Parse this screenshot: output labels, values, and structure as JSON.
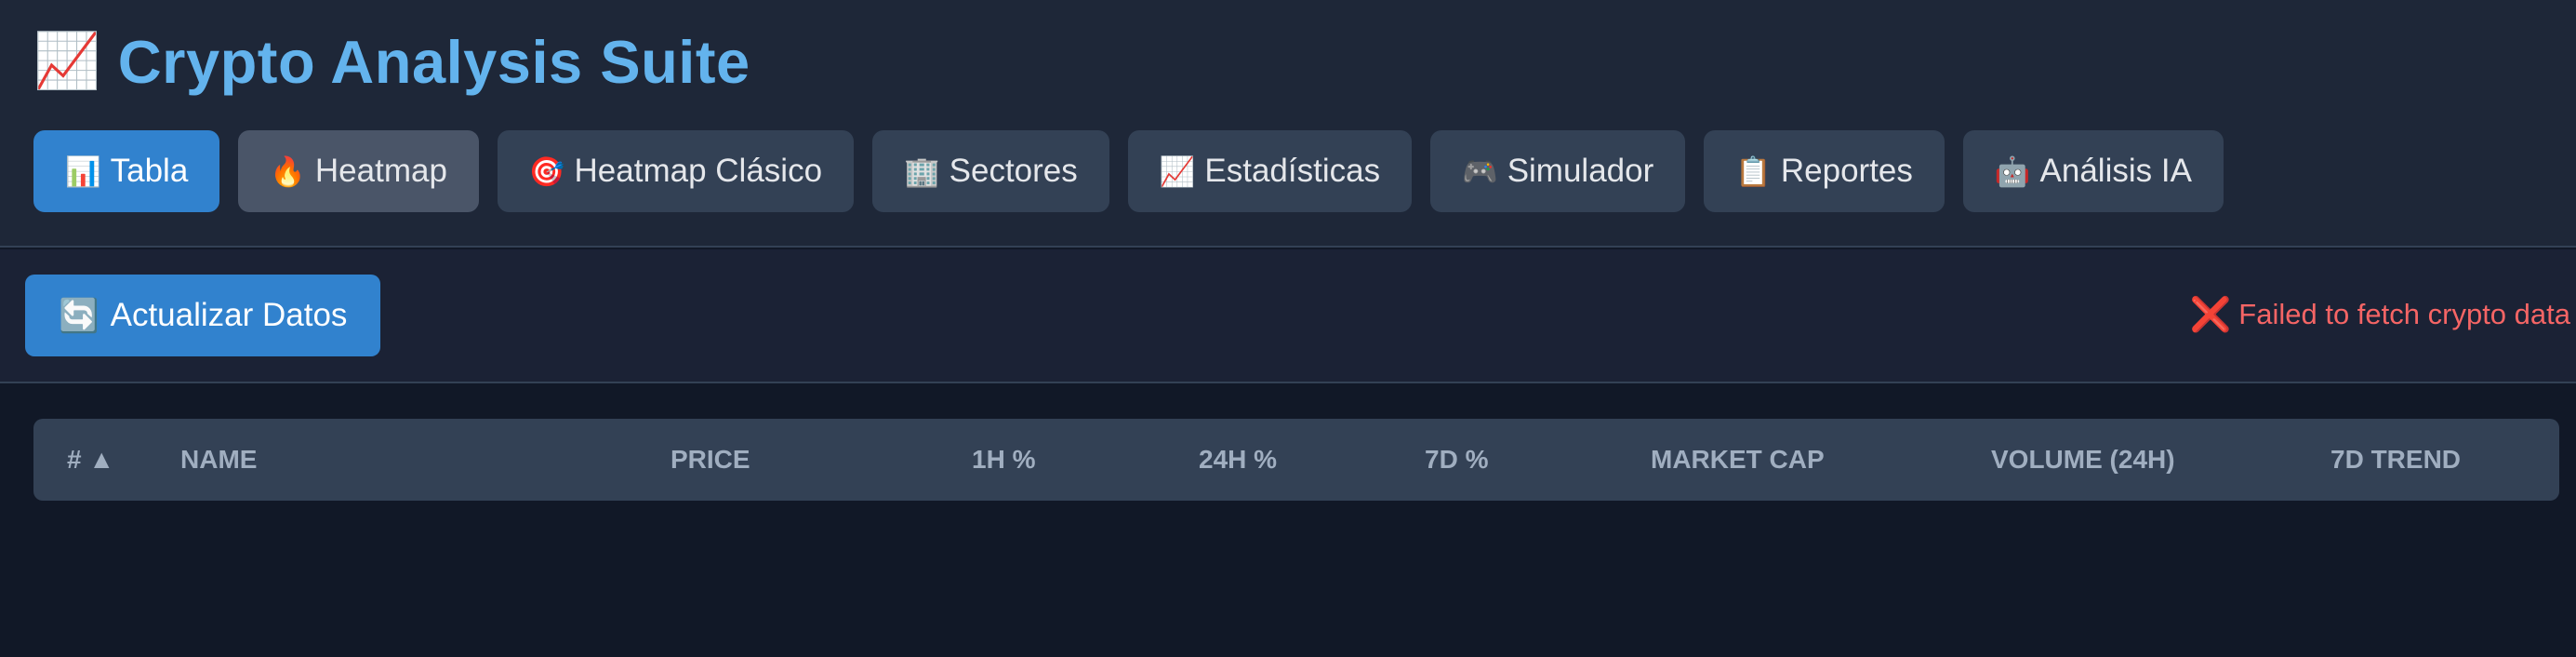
{
  "app": {
    "title_icon": "📈",
    "title": "Crypto Analysis Suite"
  },
  "tabs": [
    {
      "icon": "📊",
      "label": "Tabla"
    },
    {
      "icon": "🔥",
      "label": "Heatmap"
    },
    {
      "icon": "🎯",
      "label": "Heatmap Clásico"
    },
    {
      "icon": "🏢",
      "label": "Sectores"
    },
    {
      "icon": "📈",
      "label": "Estadísticas"
    },
    {
      "icon": "🎮",
      "label": "Simulador"
    },
    {
      "icon": "📋",
      "label": "Reportes"
    },
    {
      "icon": "🤖",
      "label": "Análisis IA"
    }
  ],
  "active_tab": "Tabla",
  "toolbar": {
    "refresh_icon": "🔄",
    "refresh_label": "Actualizar Datos",
    "error_icon": "❌",
    "error_text": "Failed to fetch crypto data"
  },
  "table": {
    "columns": [
      "# ▲",
      "NAME",
      "PRICE",
      "1H %",
      "24H %",
      "7D %",
      "MARKET CAP",
      "VOLUME (24H)",
      "7D TREND"
    ]
  },
  "colors": {
    "accent": "#3182ce",
    "title": "#63b3ed",
    "error": "#f56565",
    "background": "#111827",
    "header_bg": "#1e2738"
  }
}
